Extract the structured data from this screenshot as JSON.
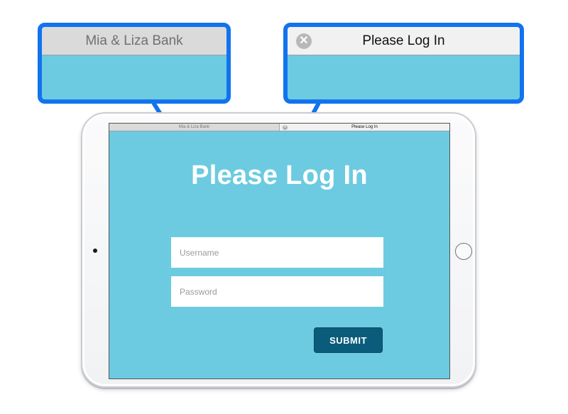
{
  "colors": {
    "screen_bg": "#6ccbe0",
    "callout_border": "#1273ee",
    "submit_bg": "#0a5c7a",
    "inactive_tab": "#dadada",
    "active_tab": "#f1f1f1"
  },
  "tabs": [
    {
      "label": "Mia & Liza Bank",
      "active": false
    },
    {
      "label": "Please Log In",
      "active": true,
      "close_icon": "close-icon",
      "close_glyph": "✕"
    }
  ],
  "login": {
    "title": "Please Log In",
    "username_placeholder": "Username",
    "password_placeholder": "Password",
    "submit_label": "SUBMIT"
  }
}
